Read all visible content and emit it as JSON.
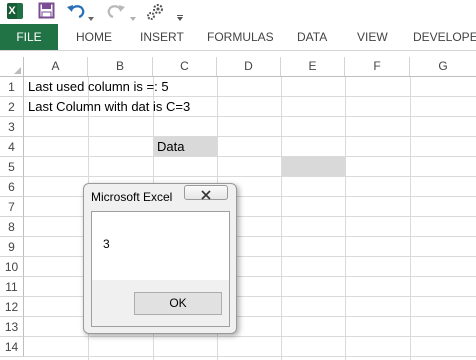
{
  "quick_access_toolbar": {
    "icons": [
      "excel-logo-icon",
      "save-icon",
      "undo-icon",
      "redo-icon",
      "macro-icon",
      "customize-qat-icon"
    ],
    "excel_logo_letter": "X",
    "colors": {
      "excel_green": "#217346",
      "excel_dark_green": "#185c37",
      "save_purple": "#7b4b94"
    }
  },
  "ribbon": {
    "tabs": [
      {
        "label": "FILE"
      },
      {
        "label": "HOME"
      },
      {
        "label": "INSERT"
      },
      {
        "label": "FORMULAS"
      },
      {
        "label": "DATA"
      },
      {
        "label": "VIEW"
      },
      {
        "label": "DEVELOPER"
      }
    ],
    "file_tab_color": "#217346"
  },
  "sheet": {
    "columns": [
      "A",
      "B",
      "C",
      "D",
      "E",
      "F",
      "G"
    ],
    "rows": [
      "1",
      "2",
      "3",
      "4",
      "5",
      "6",
      "7",
      "8",
      "9",
      "10",
      "11",
      "12",
      "13",
      "14"
    ],
    "cells": {
      "A1": "Last used column is =: 5",
      "A2": "Last Column with dat is C=3",
      "C4": "Data"
    },
    "shaded_cells": [
      "C4",
      "E5"
    ],
    "shade_color": "#d9d9d9"
  },
  "dialog": {
    "title": "Microsoft Excel",
    "message": "3",
    "ok_label": "OK"
  }
}
